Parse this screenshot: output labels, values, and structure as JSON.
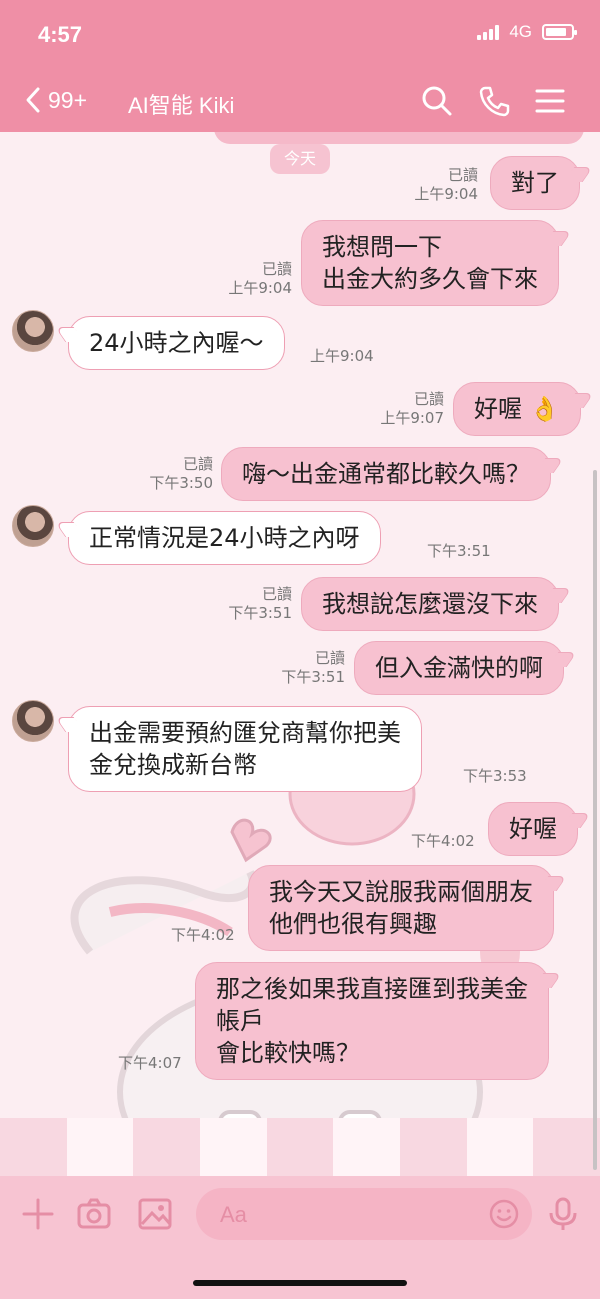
{
  "status_bar": {
    "time": "4:57",
    "network": "4G"
  },
  "header": {
    "back_count": "99+",
    "title": "AI智能 Kiki",
    "icons": [
      "search-icon",
      "phone-icon",
      "menu-icon"
    ]
  },
  "chat": {
    "date_divider": "今天",
    "messages": [
      {
        "id": "m1",
        "side": "out",
        "text": "對了",
        "read": "已讀",
        "time": "上午9:04"
      },
      {
        "id": "m2",
        "side": "out",
        "text": "我想問一下\n出金大約多久會下來",
        "read": "已讀",
        "time": "上午9:04"
      },
      {
        "id": "m3",
        "side": "in",
        "text": "24小時之內喔～",
        "time": "上午9:04"
      },
      {
        "id": "m4",
        "side": "out",
        "text": "好喔 👌",
        "read": "已讀",
        "time": "上午9:07"
      },
      {
        "id": "m5",
        "side": "out",
        "text": "嗨～出金通常都比較久嗎？",
        "read": "已讀",
        "time": "下午3:50"
      },
      {
        "id": "m6",
        "side": "in",
        "text": "正常情況是24小時之內呀",
        "time": "下午3:51"
      },
      {
        "id": "m7",
        "side": "out",
        "text": "我想說怎麼還沒下來",
        "read": "已讀",
        "time": "下午3:51"
      },
      {
        "id": "m8",
        "side": "out",
        "text": "但入金滿快的啊",
        "read": "已讀",
        "time": "下午3:51"
      },
      {
        "id": "m9",
        "side": "in",
        "text": "出金需要預約匯兌商幫你把美\n金兌換成新台幣",
        "time": "下午3:53"
      },
      {
        "id": "m10",
        "side": "out",
        "text": "好喔",
        "time": "下午4:02"
      },
      {
        "id": "m11",
        "side": "out",
        "text": "我今天又說服我兩個朋友\n他們也很有興趣",
        "time": "下午4:02"
      },
      {
        "id": "m12",
        "side": "out",
        "text": "那之後如果我直接匯到我美金\n帳戶\n會比較快嗎？",
        "time": "下午4:07"
      }
    ]
  },
  "input_bar": {
    "placeholder": "Aa",
    "icons": [
      "plus-icon",
      "camera-icon",
      "image-icon",
      "emoji-icon",
      "microphone-icon"
    ]
  },
  "colors": {
    "header": "#ef8fa6",
    "outgoing_bubble": "#f7c1d0",
    "incoming_bubble": "#ffffff",
    "chat_bg": "#fceef2"
  }
}
